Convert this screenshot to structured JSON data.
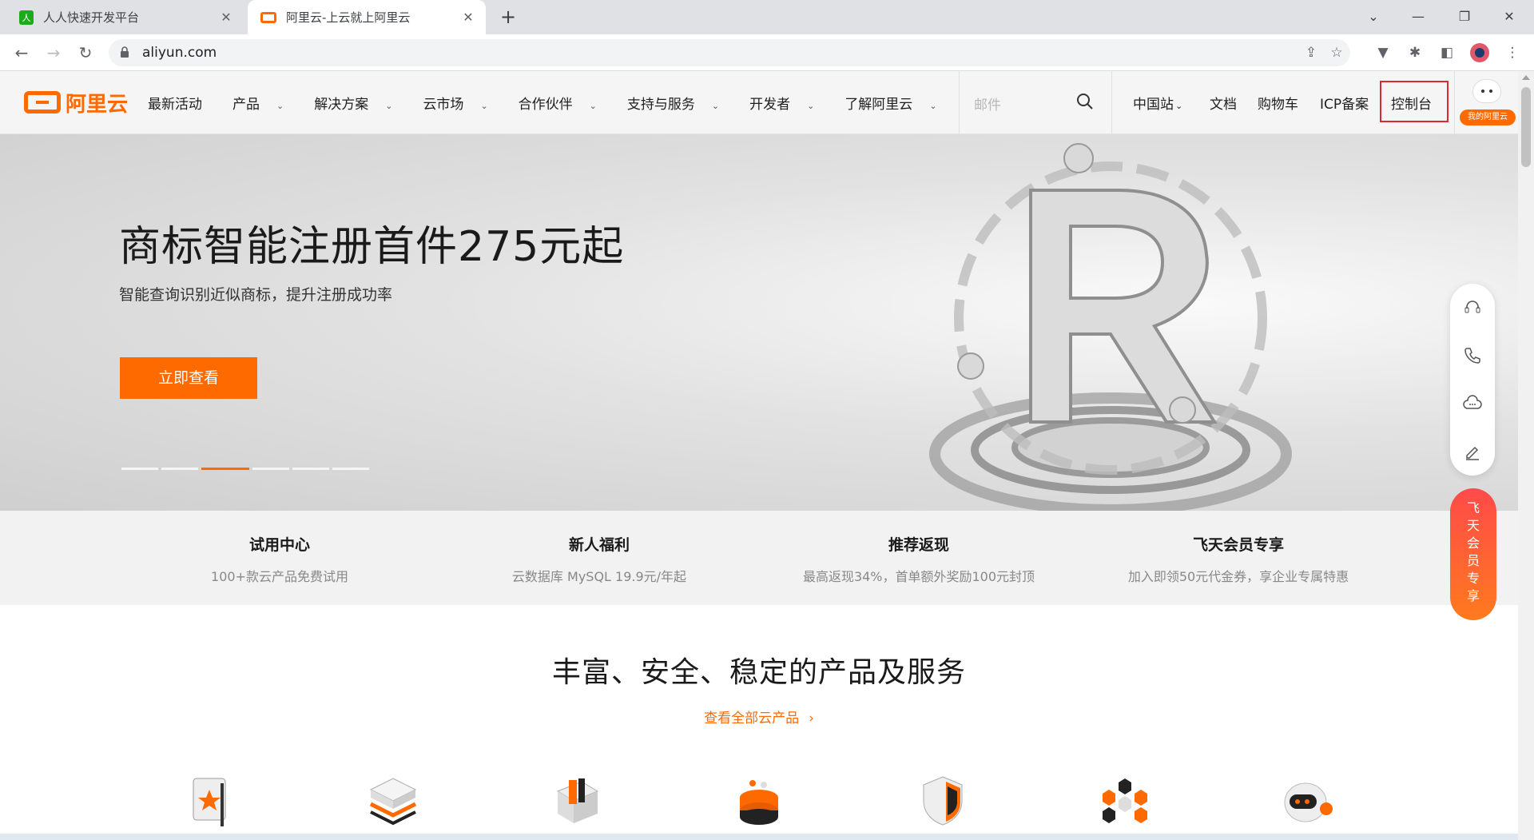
{
  "browser": {
    "tabs": [
      {
        "title": "人人快速开发平台",
        "favicon": "renren-favicon",
        "active": false
      },
      {
        "title": "阿里云-上云就上阿里云",
        "favicon": "aliyun-favicon",
        "active": true
      }
    ],
    "address": "aliyun.com",
    "window_controls": [
      "minimize-icon",
      "restore-icon",
      "close-icon"
    ]
  },
  "site": {
    "logo_text": "阿里云",
    "nav": [
      {
        "label": "最新活动",
        "dropdown": false
      },
      {
        "label": "产品",
        "dropdown": true
      },
      {
        "label": "解决方案",
        "dropdown": true
      },
      {
        "label": "云市场",
        "dropdown": true
      },
      {
        "label": "合作伙伴",
        "dropdown": true
      },
      {
        "label": "支持与服务",
        "dropdown": true
      },
      {
        "label": "开发者",
        "dropdown": true
      },
      {
        "label": "了解阿里云",
        "dropdown": true
      }
    ],
    "search_placeholder": "邮件",
    "right_nav": {
      "region": "中国站",
      "docs": "文档",
      "cart": "购物车",
      "icp": "ICP备案",
      "console": "控制台"
    },
    "my_badge": "我的阿里云"
  },
  "hero": {
    "title": "商标智能注册首件275元起",
    "subtitle": "智能查询识别近似商标，提升注册成功率",
    "button": "立即查看",
    "carousel_count": 6,
    "carousel_active_index": 2
  },
  "features": [
    {
      "title": "试用中心",
      "desc": "100+款云产品免费试用"
    },
    {
      "title": "新人福利",
      "desc": "云数据库 MySQL 19.9元/年起"
    },
    {
      "title": "推荐返现",
      "desc": "最高返现34%，首单额外奖励100元封顶"
    },
    {
      "title": "飞天会员专享",
      "desc": "加入即领50元代金券，享企业专属特惠"
    }
  ],
  "products_section": {
    "title": "丰富、安全、稳定的产品及服务",
    "link": "查看全部云产品",
    "icons": [
      "star-badge-icon",
      "server-stack-icon",
      "storage-box-icon",
      "database-icon",
      "shield-icon",
      "network-nodes-icon",
      "robot-icon"
    ]
  },
  "side_tools": [
    "customer-service-icon",
    "phone-icon",
    "cloud-chat-icon",
    "edit-icon"
  ],
  "fly_tag": [
    "飞",
    "天",
    "会",
    "员",
    "专",
    "享"
  ],
  "colors": {
    "brand": "#ff6a00",
    "highlight_border": "#e0262e"
  }
}
